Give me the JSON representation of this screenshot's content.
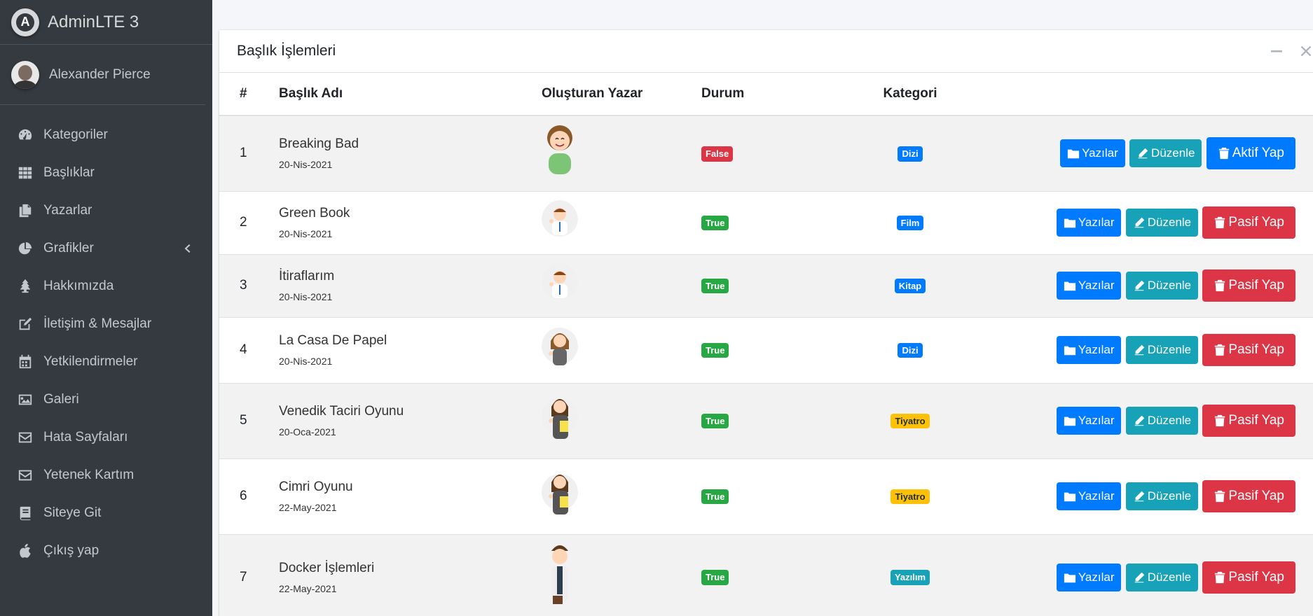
{
  "brand": {
    "name": "AdminLTE 3",
    "logo_letter": "A"
  },
  "user": {
    "name": "Alexander Pierce"
  },
  "sidebar": {
    "items": [
      {
        "label": "Kategoriler",
        "icon": "tachometer-icon"
      },
      {
        "label": "Başlıklar",
        "icon": "grid-icon"
      },
      {
        "label": "Yazarlar",
        "icon": "copy-icon"
      },
      {
        "label": "Grafikler",
        "icon": "pie-chart-icon",
        "caret": "chevron-left-icon"
      },
      {
        "label": "Hakkımızda",
        "icon": "tree-icon"
      },
      {
        "label": "İletişim & Mesajlar",
        "icon": "edit-icon"
      },
      {
        "label": "Yetkilendirmeler",
        "icon": "calendar-icon"
      },
      {
        "label": "Galeri",
        "icon": "image-icon"
      },
      {
        "label": "Hata Sayfaları",
        "icon": "envelope-icon"
      },
      {
        "label": "Yetenek Kartım",
        "icon": "envelope-icon"
      },
      {
        "label": "Siteye Git",
        "icon": "book-icon"
      },
      {
        "label": "Çıkış yap",
        "icon": "apple-icon"
      }
    ]
  },
  "card": {
    "title": "Başlık İşlemleri"
  },
  "table": {
    "headers": [
      "#",
      "Başlık Adı",
      "Oluşturan Yazar",
      "Durum",
      "Kategori"
    ],
    "rows": [
      {
        "num": "1",
        "title": "Breaking Bad",
        "date": "20-Nis-2021",
        "status": "False",
        "status_color": "danger",
        "category": "Dizi",
        "category_color": "primary",
        "toggle_label": "Aktif Yap",
        "toggle_color": "active-btn"
      },
      {
        "num": "2",
        "title": "Green Book",
        "date": "20-Nis-2021",
        "status": "True",
        "status_color": "success",
        "category": "Film",
        "category_color": "primary",
        "toggle_label": "Pasif Yap",
        "toggle_color": "danger"
      },
      {
        "num": "3",
        "title": "İtiraflarım",
        "date": "20-Nis-2021",
        "status": "True",
        "status_color": "success",
        "category": "Kitap",
        "category_color": "primary",
        "toggle_label": "Pasif Yap",
        "toggle_color": "danger"
      },
      {
        "num": "4",
        "title": "La Casa De Papel",
        "date": "20-Nis-2021",
        "status": "True",
        "status_color": "success",
        "category": "Dizi",
        "category_color": "primary",
        "toggle_label": "Pasif Yap",
        "toggle_color": "danger"
      },
      {
        "num": "5",
        "title": "Venedik Taciri Oyunu",
        "date": "20-Oca-2021",
        "status": "True",
        "status_color": "success",
        "category": "Tiyatro",
        "category_color": "warning",
        "toggle_label": "Pasif Yap",
        "toggle_color": "danger"
      },
      {
        "num": "6",
        "title": "Cimri Oyunu",
        "date": "22-May-2021",
        "status": "True",
        "status_color": "success",
        "category": "Tiyatro",
        "category_color": "warning",
        "toggle_label": "Pasif Yap",
        "toggle_color": "danger"
      },
      {
        "num": "7",
        "title": "Docker İşlemleri",
        "date": "22-May-2021",
        "status": "True",
        "status_color": "success",
        "category": "Yazılım",
        "category_color": "info",
        "toggle_label": "Pasif Yap",
        "toggle_color": "danger"
      }
    ],
    "actions": {
      "posts_label": "Yazılar",
      "edit_label": "Düzenle"
    }
  }
}
